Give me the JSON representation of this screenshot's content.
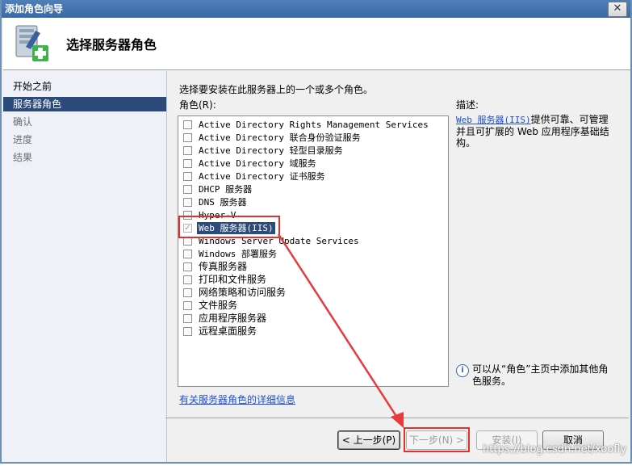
{
  "window": {
    "title": "添加角色向导",
    "close_glyph": "✕"
  },
  "header": {
    "title": "选择服务器角色",
    "icon": "server-add-icon"
  },
  "nav": {
    "items": [
      {
        "label": "开始之前",
        "state": "normal"
      },
      {
        "label": "服务器角色",
        "state": "selected"
      },
      {
        "label": "确认",
        "state": "disabled"
      },
      {
        "label": "进度",
        "state": "disabled"
      },
      {
        "label": "结果",
        "state": "disabled"
      }
    ]
  },
  "main": {
    "instruction": "选择要安装在此服务器上的一个或多个角色。",
    "roles_label": "角色(R):",
    "roles": [
      {
        "label": "Active Directory Rights Management Services",
        "checked": false
      },
      {
        "label": "Active Directory 联合身份验证服务",
        "checked": false
      },
      {
        "label": "Active Directory 轻型目录服务",
        "checked": false
      },
      {
        "label": "Active Directory 域服务",
        "checked": false
      },
      {
        "label": "Active Directory 证书服务",
        "checked": false
      },
      {
        "label": "DHCP 服务器",
        "checked": false
      },
      {
        "label": "DNS 服务器",
        "checked": false
      },
      {
        "label": "Hyper-V",
        "checked": false
      },
      {
        "label": "Web 服务器(IIS)",
        "checked": true
      },
      {
        "label": "Windows Server Update Services",
        "checked": false
      },
      {
        "label": "Windows 部署服务",
        "checked": false
      },
      {
        "label": "传真服务器",
        "checked": false
      },
      {
        "label": "打印和文件服务",
        "checked": false
      },
      {
        "label": "网络策略和访问服务",
        "checked": false
      },
      {
        "label": "文件服务",
        "checked": false
      },
      {
        "label": "应用程序服务器",
        "checked": false
      },
      {
        "label": "远程桌面服务",
        "checked": false
      }
    ],
    "description_label": "描述:",
    "description_link": "Web 服务器(IIS)",
    "description_text": "提供可靠、可管理并且可扩展的 Web 应用程序基础结构。",
    "info_text": "可以从“角色”主页中添加其他角色服务。",
    "more_info_link": "有关服务器角色的详细信息"
  },
  "buttons": {
    "back": "< 上一步(P)",
    "next": "下一步(N) >",
    "install": "安装(I)",
    "cancel": "取消"
  },
  "watermark": "https://blog.csdn.net/xoofly",
  "colors": {
    "highlight": "#e03030",
    "selection": "#2c4a7a",
    "link": "#1f4fd1"
  }
}
